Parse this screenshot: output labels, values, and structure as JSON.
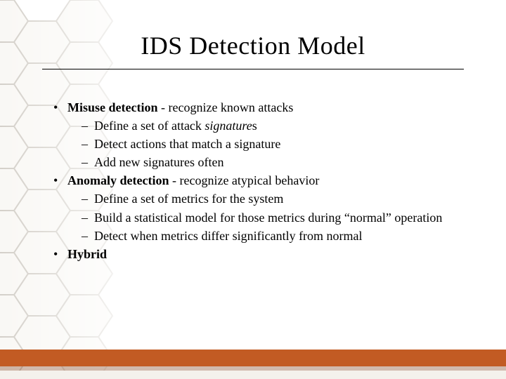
{
  "slide": {
    "title": "IDS Detection Model",
    "bullets": [
      {
        "bold": "Misuse detection",
        "rest": " - recognize known attacks",
        "subs": [
          {
            "pre": "Define a set of attack ",
            "ital": "signature",
            "post": "s"
          },
          {
            "text": "Detect actions that match a signature"
          },
          {
            "text": "Add new signatures often"
          }
        ]
      },
      {
        "bold": "Anomaly detection",
        "rest": " - recognize atypical behavior",
        "subs": [
          {
            "text": "Define a set of metrics for the system"
          },
          {
            "text": "Build a statistical model for those metrics during “normal” operation"
          },
          {
            "text": "Detect when metrics differ significantly from normal"
          }
        ]
      },
      {
        "bold": "Hybrid",
        "rest": "",
        "subs": []
      }
    ],
    "accent_color": "#c25b23"
  }
}
